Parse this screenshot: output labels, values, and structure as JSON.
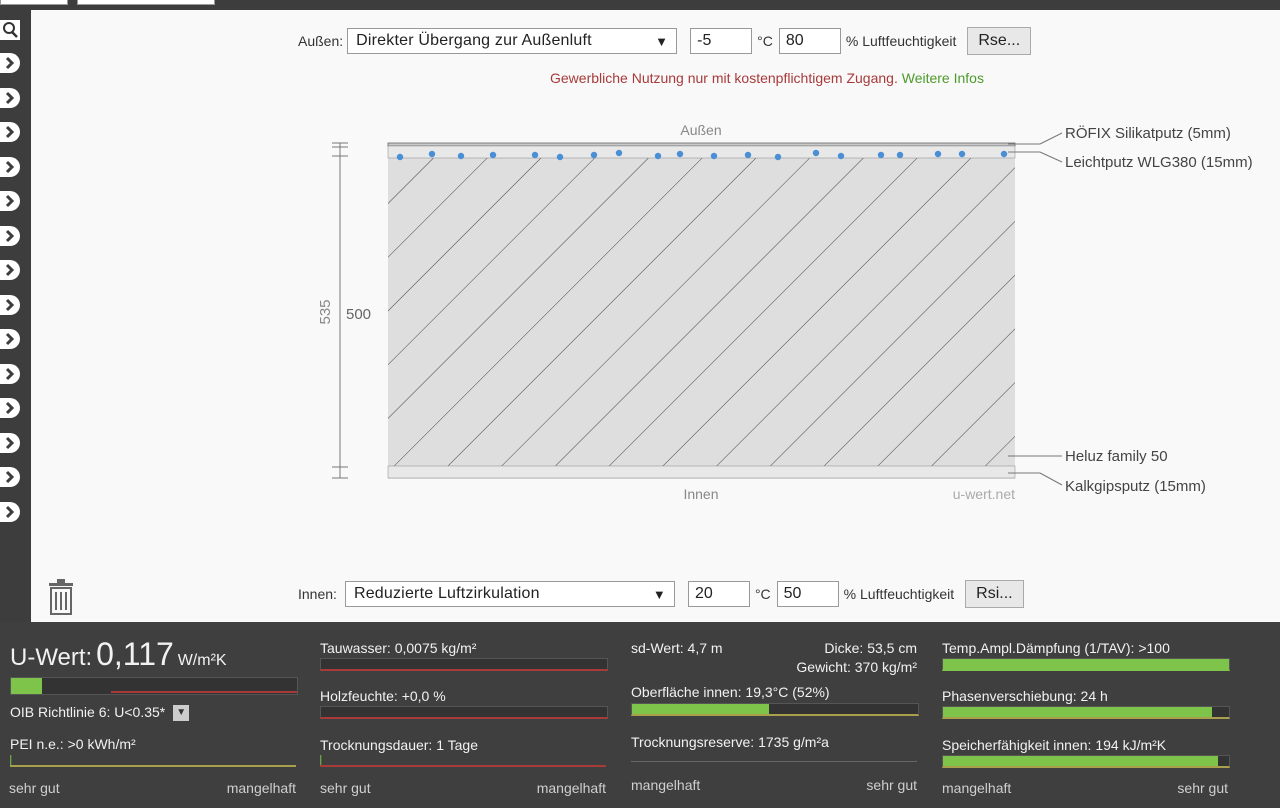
{
  "outside": {
    "label": "Außen:",
    "transition": "Direkter Übergang zur Außenluft",
    "temperature": "-5",
    "temp_unit": "°C",
    "humidity": "80",
    "humidity_unit": "% Luftfeuchtigkeit",
    "rse_button": "Rse..."
  },
  "inside": {
    "label": "Innen:",
    "transition": "Reduzierte Luftzirkulation",
    "temperature": "20",
    "temp_unit": "°C",
    "humidity": "50",
    "humidity_unit": "% Luftfeuchtigkeit",
    "rsi_button": "Rsi..."
  },
  "notice": {
    "text": "Gewerbliche Nutzung nur mit kostenpflichtigem Zugang.",
    "link": "Weitere Infos"
  },
  "diagram": {
    "top_label": "Außen",
    "bottom_label": "Innen",
    "watermark": "u-wert.net",
    "total_dim": "535",
    "inner_dim": "500",
    "layers": [
      "RÖFIX Silikatputz (5mm)",
      "Leichtputz WLG380 (15mm)",
      "Heluz family 50",
      "Kalkgipsputz (15mm)"
    ]
  },
  "results": {
    "u_label": "U-Wert:",
    "u_value": "0,117",
    "u_unit": "W/m²K",
    "u_bar_fill": 0.11,
    "oib": "OIB Richtlinie 6: U<0.35*",
    "pei": "PEI n.e.: >0 kWh/m²",
    "tauwasser": "Tauwasser: 0,0075 kg/m²",
    "holzfeuchte": "Holzfeuchte: +0,0 %",
    "trocknungsdauer": "Trocknungsdauer: 1 Tage",
    "sd_wert": "sd-Wert: 4,7 m",
    "dicke": "Dicke: 53,5 cm",
    "gewicht": "Gewicht: 370 kg/m²",
    "oberflaeche": "Oberfläche innen: 19,3°C (52%)",
    "oberflaeche_fill": 0.48,
    "trocknungsreserve": "Trocknungsreserve: 1735 g/m²a",
    "tav": "Temp.Ampl.Dämpfung (1/TAV): >100",
    "tav_fill": 1.0,
    "phase": "Phasenverschiebung: 24 h",
    "phase_fill": 0.94,
    "speicher": "Speicherfähigkeit innen: 194 kJ/m²K",
    "speicher_fill": 0.96,
    "scale_good": "sehr gut",
    "scale_bad": "mangelhaft"
  },
  "colors": {
    "accent_green": "#7ec34a",
    "warn_red": "#a83a3a",
    "link_green": "#4d9a2a",
    "panel_bg": "#3f3f3f"
  }
}
